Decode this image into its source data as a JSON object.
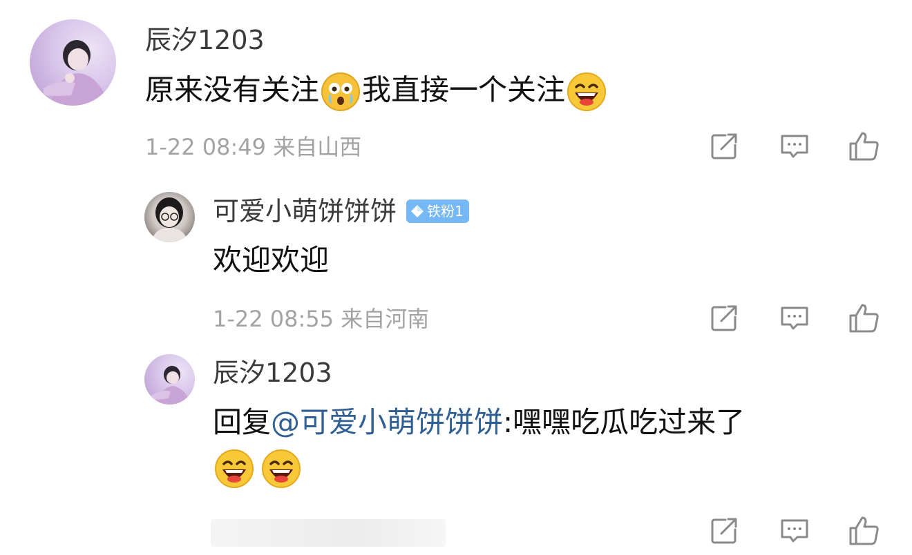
{
  "comment": {
    "username": "辰汐1203",
    "text_part1": "原来没有关注",
    "emoji1": "flushed-crying-emoji",
    "text_part2": "我直接一个关注",
    "emoji2": "laughing-emoji",
    "meta": "1-22 08:49 来自山西"
  },
  "replies": [
    {
      "username": "可爱小萌饼饼饼",
      "badge": "铁粉1",
      "text": "欢迎欢迎",
      "meta": "1-22 08:55 来自河南"
    },
    {
      "username": "辰汐1203",
      "prefix": "回复",
      "mention": "@可爱小萌饼饼饼",
      "text": ":嘿嘿吃瓜吃过来了",
      "emojis": [
        "laughing-emoji",
        "laughing-emoji"
      ]
    }
  ],
  "icons": {
    "share": "share-icon",
    "comment": "comment-icon",
    "like": "thumbs-up-icon"
  },
  "colors": {
    "username": "#3b3b3b",
    "text": "#111111",
    "meta": "#a3a3a3",
    "mention": "#2f5f93",
    "badge": "#76b8f5",
    "icon": "#8a8a8a"
  }
}
